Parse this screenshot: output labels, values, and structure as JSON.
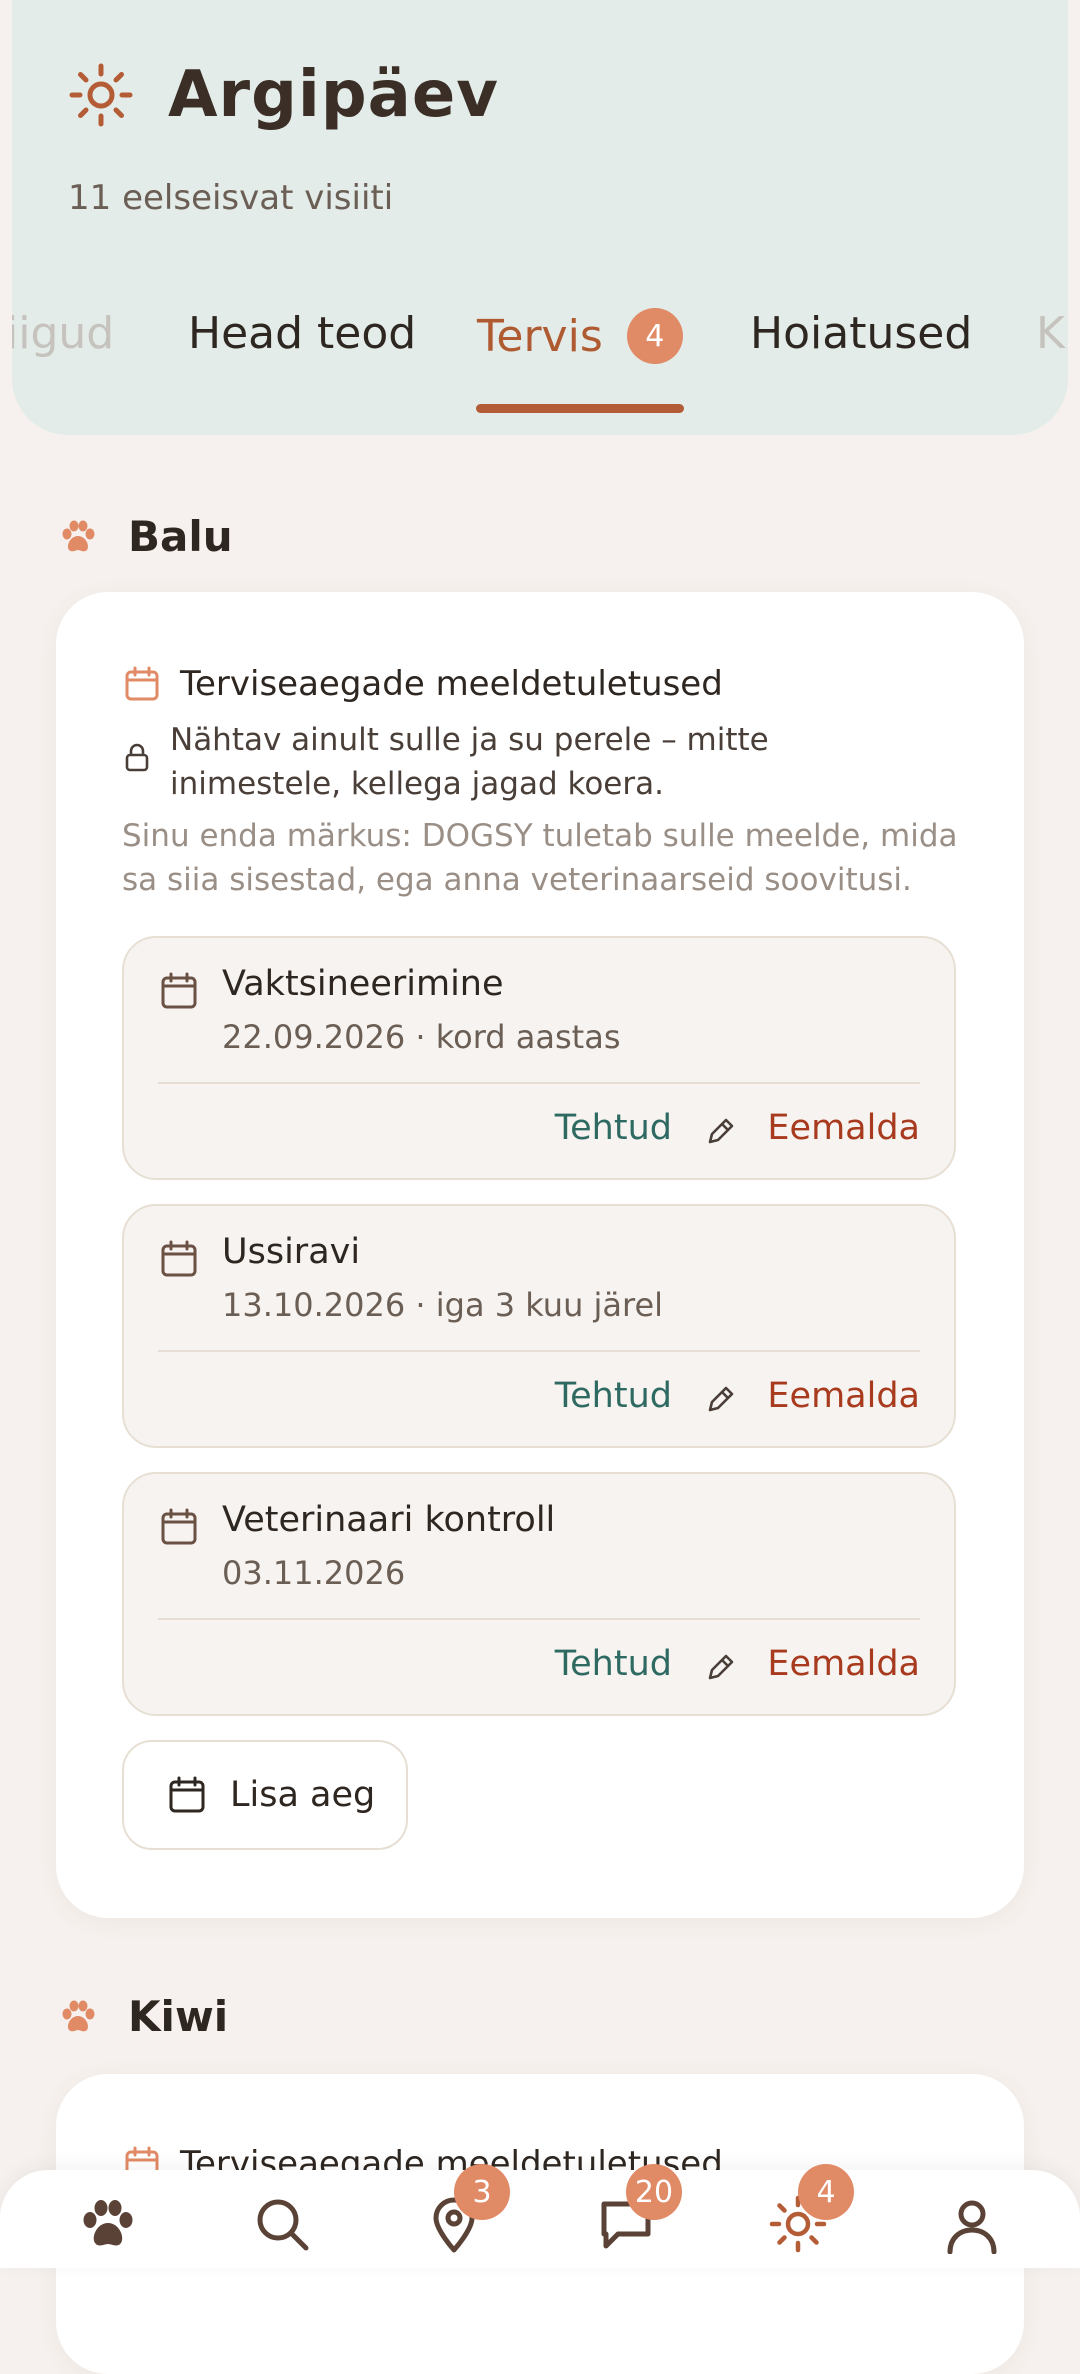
{
  "header": {
    "title": "Argipäev",
    "subtitle": "11 eelseisvat visiiti",
    "tabs": [
      {
        "label": "iigud"
      },
      {
        "label": "Head teod"
      },
      {
        "label": "Tervis",
        "badge": "4"
      },
      {
        "label": "Hoiatused"
      },
      {
        "label": "K"
      }
    ],
    "active_tab": "Tervis"
  },
  "colors": {
    "accent": "#b45c36",
    "badge": "#e18a66",
    "done": "#2f6a62",
    "remove": "#a83a1e",
    "header_bg": "#e3ece8"
  },
  "dogs": [
    {
      "name": "Balu",
      "card": {
        "title": "Terviseaegade meeldetuletused",
        "privacy": "Nähtav ainult sulle ja su perele – mitte inimestele, kellega jagad koera.",
        "note": "Sinu enda märkus: DOGSY tuletab sulle meelde, mida sa siia sisestad, ega anna veterinaarseid soovitusi.",
        "reminders": [
          {
            "name": "Vaktsineerimine",
            "when": "22.09.2026 · kord aastas"
          },
          {
            "name": "Ussiravi",
            "when": "13.10.2026 · iga 3 kuu järel"
          },
          {
            "name": "Veterinaari kontroll",
            "when": "03.11.2026"
          }
        ],
        "done_label": "Tehtud",
        "remove_label": "Eemalda",
        "add_label": "Lisa aeg"
      }
    },
    {
      "name": "Kiwi",
      "card": {
        "title": "Terviseaegade meeldetuletused"
      }
    }
  ],
  "bottom_nav": [
    {
      "icon": "paw-icon"
    },
    {
      "icon": "search-icon"
    },
    {
      "icon": "map-pin-icon",
      "badge": "3"
    },
    {
      "icon": "chat-icon",
      "badge": "20"
    },
    {
      "icon": "sun-icon",
      "badge": "4"
    },
    {
      "icon": "profile-icon"
    }
  ]
}
